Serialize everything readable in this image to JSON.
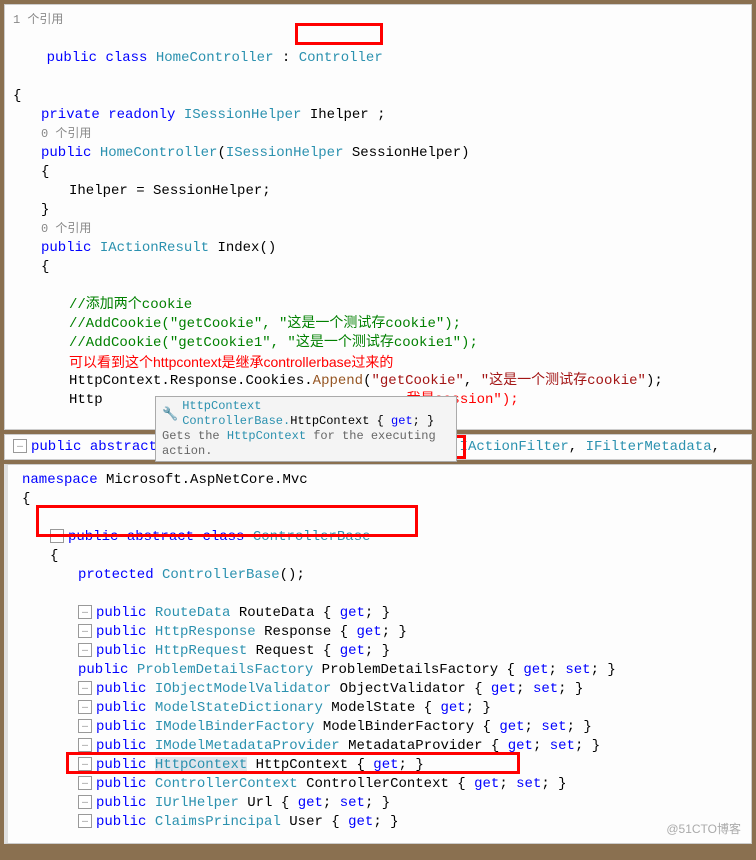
{
  "refs": {
    "one": "1 个引用",
    "zero": "0 个引用"
  },
  "kw": {
    "public": "public",
    "class": "class",
    "private": "private",
    "readonly": "readonly",
    "abstract": "abstract",
    "protected": "protected",
    "namespace": "namespace"
  },
  "cls": {
    "HomeController": "HomeController",
    "Controller": "Controller",
    "ControllerBase": "ControllerBase",
    "ISessionHelper": "ISessionHelper",
    "IActionResult": "IActionResult",
    "IActionFilter": "IActionFilter",
    "IFilterMetadata": "IFilterMetadata",
    "RouteData": "RouteData",
    "HttpResponse": "HttpResponse",
    "HttpRequest": "HttpRequest",
    "ProblemDetailsFactory": "ProblemDetailsFactory",
    "IObjectModelValidator": "IObjectModelValidator",
    "ModelStateDictionary": "ModelStateDictionary",
    "IModelBinderFactory": "IModelBinderFactory",
    "IModelMetadataProvider": "IModelMetadataProvider",
    "HttpContext": "HttpContext",
    "ControllerContext": "ControllerContext",
    "IUrlHelper": "IUrlHelper",
    "ClaimsPrincipal": "ClaimsPrincipal"
  },
  "vars": {
    "Ihelper": "Ihelper",
    "SessionHelper": "SessionHelper",
    "Index": "Index",
    "Append": "Append",
    "Response": "Response",
    "Cookies": "Cookies",
    "HttpContextProp": "HttpContext",
    "Http_partial": "Http",
    "ns": "Microsoft.AspNetCore.Mvc"
  },
  "str": {
    "getCookie": "\"getCookie\"",
    "getCookie1": "\"getCookie1\"",
    "test": "\"这是一个测试存cookie\"",
    "test1": "\"这是一个测试存cookie1\"",
    "session": "我是session\");"
  },
  "comments": {
    "add2": "//添加两个cookie",
    "ac1": "//AddCookie(\"getCookie\", \"这是一个测试存cookie\");",
    "ac2": "//AddCookie(\"getCookie1\", \"这是一个测试存cookie1\");"
  },
  "annotation": "可以看到这个httpcontext是继承controllerbase过来的",
  "tooltip": {
    "sig1": "HttpContext ControllerBase.",
    "sig2": "HttpContext { ",
    "sig3": "get",
    "sig4": "; }",
    "desc1": "Gets the ",
    "desc2": "HttpContext",
    "desc3": " for the executing action."
  },
  "props": {
    "RouteData": "RouteData",
    "Response": "Response",
    "Request": "Request",
    "ProblemDetailsFactory": "ProblemDetailsFactory",
    "ObjectValidator": "ObjectValidator",
    "ModelState": "ModelState",
    "ModelBinderFactory": "ModelBinderFactory",
    "MetadataProvider": "MetadataProvider",
    "HttpContext": "HttpContext",
    "ControllerContext": "ControllerContext",
    "Url": "Url",
    "User": "User"
  },
  "get": "get",
  "set": "set",
  "watermark": "@51CTO博客"
}
